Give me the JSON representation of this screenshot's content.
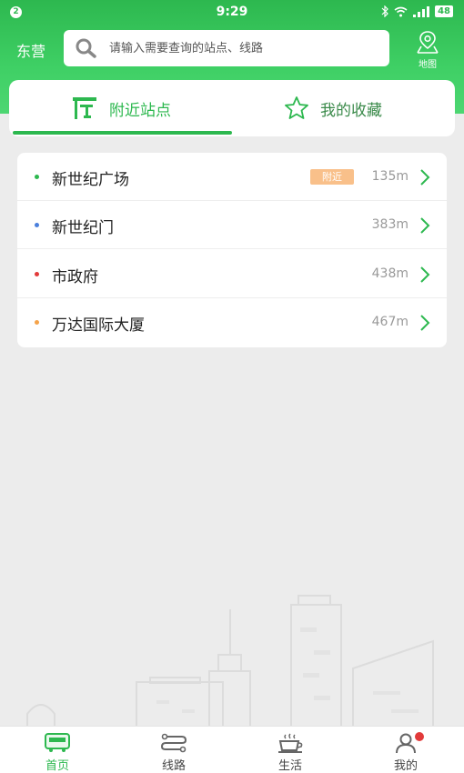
{
  "status_bar": {
    "notification_count": "2",
    "time": "9:29",
    "battery": "48"
  },
  "header": {
    "city": "东营",
    "search_placeholder": "请输入需要查询的站点、线路",
    "map_label": "地图"
  },
  "tabs": [
    {
      "label": "附近站点",
      "icon": "bus-stop-icon",
      "active": true
    },
    {
      "label": "我的收藏",
      "icon": "star-icon",
      "active": false
    }
  ],
  "stops": [
    {
      "name": "新世纪广场",
      "tag": "附近",
      "distance": "135m",
      "dot_color": "#2db84f"
    },
    {
      "name": "新世纪门",
      "tag": "",
      "distance": "383m",
      "dot_color": "#4a7fdc"
    },
    {
      "name": "市政府",
      "tag": "",
      "distance": "438m",
      "dot_color": "#e23a3a"
    },
    {
      "name": "万达国际大厦",
      "tag": "",
      "distance": "467m",
      "dot_color": "#f5a34a"
    }
  ],
  "bottom_nav": [
    {
      "label": "首页",
      "icon": "bus-icon",
      "active": true
    },
    {
      "label": "线路",
      "icon": "route-icon",
      "active": false
    },
    {
      "label": "生活",
      "icon": "coffee-cup-icon",
      "active": false
    },
    {
      "label": "我的",
      "icon": "user-icon",
      "active": false,
      "badge": true
    }
  ],
  "colors": {
    "brand_green": "#2db84f",
    "tag_orange": "#f9c08a",
    "badge_red": "#e23a3a"
  }
}
